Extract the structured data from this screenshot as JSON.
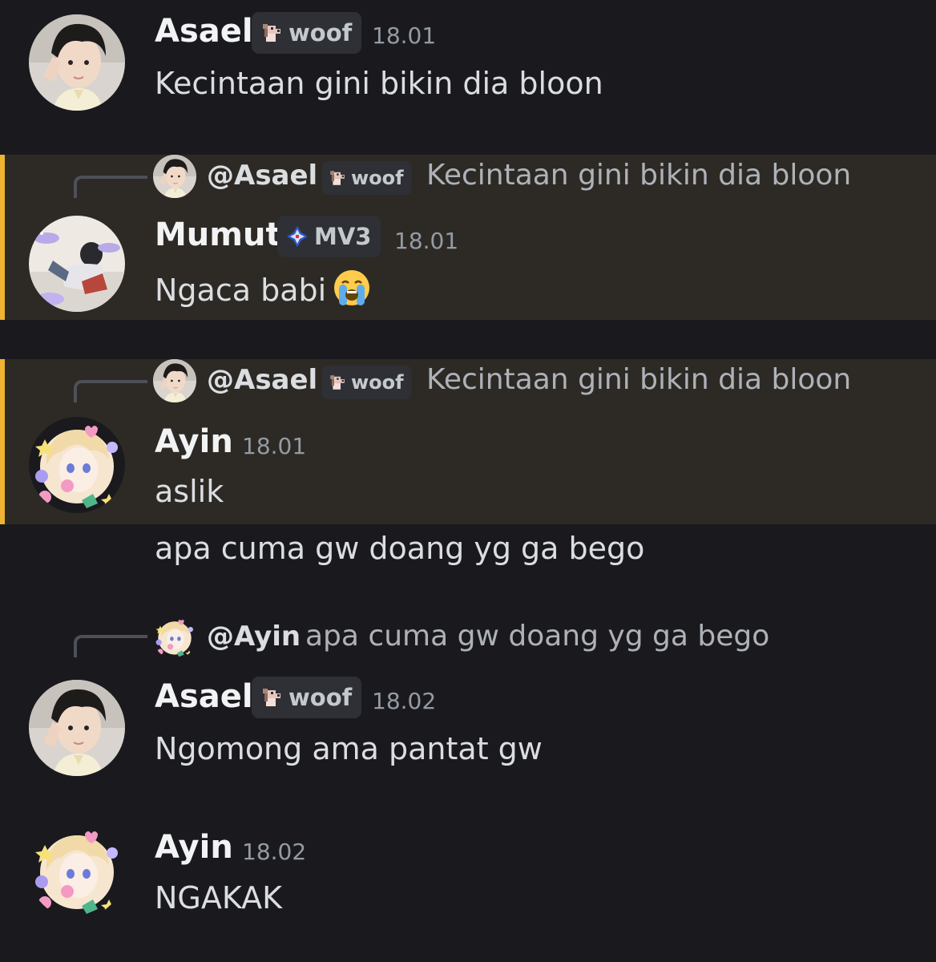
{
  "messages": [
    {
      "author": "Asael",
      "tag": "woof",
      "time": "18.01",
      "text": "Kecintaan gini bikin dia bloon"
    },
    {
      "reply_to": {
        "mention": "@Asael",
        "tag": "woof",
        "text": "Kecintaan gini bikin dia bloon"
      },
      "author": "Mumut",
      "tag": "MV3",
      "time": "18.01",
      "text": "Ngaca babi",
      "emoji": "loudly-crying-face"
    },
    {
      "reply_to": {
        "mention": "@Asael",
        "tag": "woof",
        "text": "Kecintaan gini bikin dia bloon"
      },
      "author": "Ayin",
      "time": "18.01",
      "text": "aslik",
      "followup": "apa cuma gw doang yg ga bego"
    },
    {
      "reply_to": {
        "mention": "@Ayin",
        "text": "apa cuma gw doang yg ga bego"
      },
      "author": "Asael",
      "tag": "woof",
      "time": "18.02",
      "text": "Ngomong ama pantat gw"
    },
    {
      "author": "Ayin",
      "time": "18.02",
      "text": "NGAKAK"
    }
  ],
  "colors": {
    "background": "#1a1a1e",
    "mention_background": "#2d2a26",
    "mention_bar": "#f0b232",
    "tag_background": "#2e3035",
    "timestamp": "#949ba4"
  }
}
